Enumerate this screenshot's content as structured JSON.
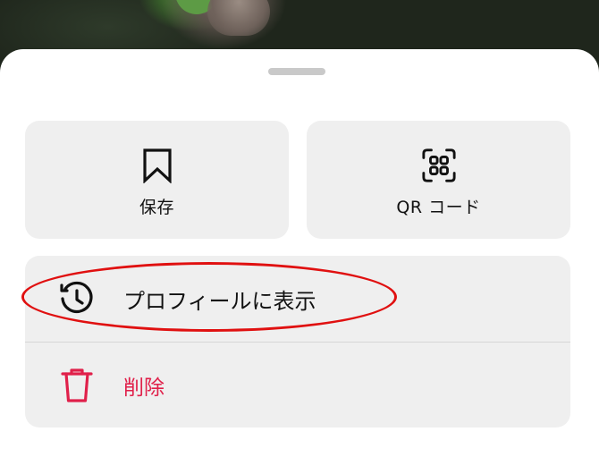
{
  "actions": {
    "save_label": "保存",
    "qr_label": "QR コード"
  },
  "menu": {
    "view_on_profile_label": "プロフィールに表示",
    "delete_label": "削除"
  },
  "icons": {
    "save": "bookmark-icon",
    "qr": "qr-code-icon",
    "view_on_profile": "history-icon",
    "delete": "trash-icon"
  },
  "colors": {
    "danger": "#e0204a",
    "annotation": "#e01010",
    "tile_bg": "#efefef"
  }
}
